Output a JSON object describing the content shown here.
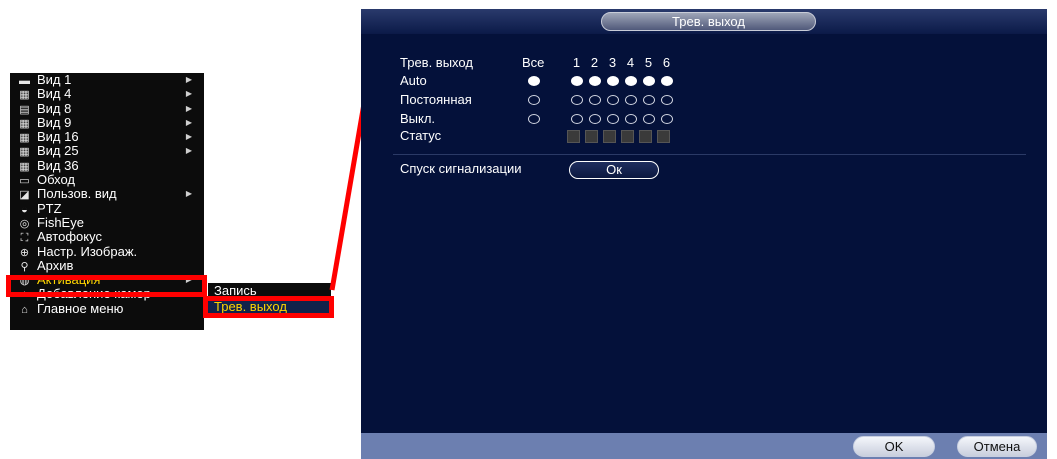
{
  "context_menu": {
    "items": [
      {
        "label": "Вид 1",
        "icon": "view-1-icon",
        "glyph": "▬",
        "submenu": true
      },
      {
        "label": "Вид 4",
        "icon": "view-4-icon",
        "glyph": "▦",
        "submenu": true
      },
      {
        "label": "Вид 8",
        "icon": "view-8-icon",
        "glyph": "▤",
        "submenu": true
      },
      {
        "label": "Вид 9",
        "icon": "view-9-icon",
        "glyph": "▦",
        "submenu": true
      },
      {
        "label": "Вид 16",
        "icon": "view-16-icon",
        "glyph": "▦",
        "submenu": true
      },
      {
        "label": "Вид 25",
        "icon": "view-25-icon",
        "glyph": "▦",
        "submenu": true
      },
      {
        "label": "Вид 36",
        "icon": "view-36-icon",
        "glyph": "▦",
        "submenu": false
      },
      {
        "label": "Обход",
        "icon": "tour-icon",
        "glyph": "▭",
        "submenu": false
      },
      {
        "label": "Пользов. вид",
        "icon": "custom-view-icon",
        "glyph": "◪",
        "submenu": true
      },
      {
        "label": "PTZ",
        "icon": "ptz-icon",
        "glyph": "◒",
        "submenu": false
      },
      {
        "label": "FishEye",
        "icon": "fisheye-icon",
        "glyph": "◎",
        "submenu": false
      },
      {
        "label": "Автофокус",
        "icon": "autofocus-icon",
        "glyph": "⛶",
        "submenu": false
      },
      {
        "label": "Настр. Изображ.",
        "icon": "image-settings-icon",
        "glyph": "⊕",
        "submenu": false
      },
      {
        "label": "Архив",
        "icon": "search-icon",
        "glyph": "⚲",
        "submenu": false
      },
      {
        "label": "Активация",
        "icon": "activation-icon",
        "glyph": "◍",
        "submenu": true
      },
      {
        "label": "Добавление камер",
        "icon": "add-camera-icon",
        "glyph": "+",
        "submenu": false
      },
      {
        "label": "Главное меню",
        "icon": "home-icon",
        "glyph": "⌂",
        "submenu": false
      }
    ]
  },
  "submenu": {
    "items": [
      {
        "label": "Запись"
      },
      {
        "label": "Трев. выход"
      }
    ]
  },
  "panel": {
    "title": "Трев. выход",
    "header_label": "Трев. выход",
    "all_label": "Все",
    "channels": [
      "1",
      "2",
      "3",
      "4",
      "5",
      "6"
    ],
    "rows": [
      {
        "label": "Auto",
        "all": true,
        "values": [
          true,
          true,
          true,
          true,
          true,
          true
        ]
      },
      {
        "label": "Постоянная",
        "all": false,
        "values": [
          false,
          false,
          false,
          false,
          false,
          false
        ]
      },
      {
        "label": "Выкл.",
        "all": false,
        "values": [
          false,
          false,
          false,
          false,
          false,
          false
        ]
      }
    ],
    "status_label": "Статус",
    "alarm_release_label": "Спуск сигнализации",
    "ok_inline": "Ок",
    "ok_button": "OK",
    "cancel_button": "Отмена"
  },
  "colors": {
    "menu_active": "#ffd400",
    "highlight": "#ff0000",
    "panel_bg": "#04113a"
  }
}
